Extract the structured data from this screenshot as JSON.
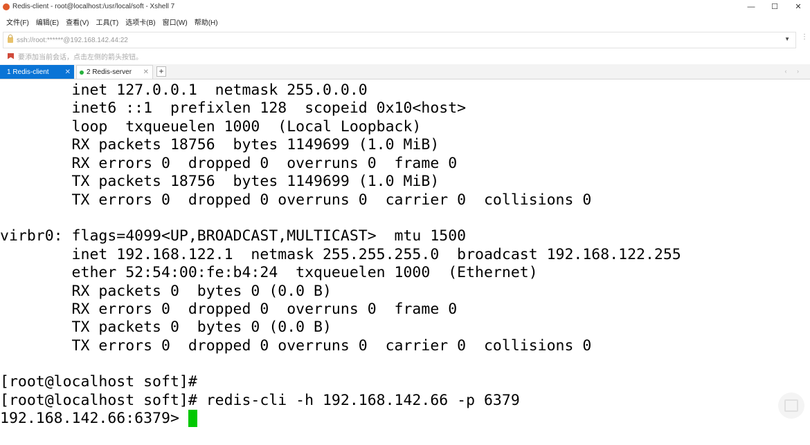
{
  "window": {
    "title": "Redis-client - root@localhost:/usr/local/soft - Xshell 7",
    "minimize": "—",
    "maximize": "☐",
    "close": "✕"
  },
  "menu": [
    "文件(F)",
    "编辑(E)",
    "查看(V)",
    "工具(T)",
    "选项卡(B)",
    "窗口(W)",
    "帮助(H)"
  ],
  "address": {
    "value": "ssh://root:******@192.168.142.44:22"
  },
  "info": {
    "text": "要添加当前会话，点击左侧的箭头按钮。"
  },
  "tabs": [
    {
      "label": "1 Redis-client",
      "close": "✕",
      "active": true
    },
    {
      "label": "2 Redis-server",
      "close": "✕",
      "active": false
    }
  ],
  "tab_add": "+",
  "tab_nav": "‹ ›",
  "terminal": {
    "lines": [
      "        inet 127.0.0.1  netmask 255.0.0.0",
      "        inet6 ::1  prefixlen 128  scopeid 0x10<host>",
      "        loop  txqueuelen 1000  (Local Loopback)",
      "        RX packets 18756  bytes 1149699 (1.0 MiB)",
      "        RX errors 0  dropped 0  overruns 0  frame 0",
      "        TX packets 18756  bytes 1149699 (1.0 MiB)",
      "        TX errors 0  dropped 0 overruns 0  carrier 0  collisions 0",
      "",
      "virbr0: flags=4099<UP,BROADCAST,MULTICAST>  mtu 1500",
      "        inet 192.168.122.1  netmask 255.255.255.0  broadcast 192.168.122.255",
      "        ether 52:54:00:fe:b4:24  txqueuelen 1000  (Ethernet)",
      "        RX packets 0  bytes 0 (0.0 B)",
      "        RX errors 0  dropped 0  overruns 0  frame 0",
      "        TX packets 0  bytes 0 (0.0 B)",
      "        TX errors 0  dropped 0 overruns 0  carrier 0  collisions 0",
      "",
      "[root@localhost soft]#",
      "[root@localhost soft]# redis-cli -h 192.168.142.66 -p 6379"
    ],
    "prompt": "192.168.142.66:6379> ",
    "cursor_color": "#00c800"
  }
}
